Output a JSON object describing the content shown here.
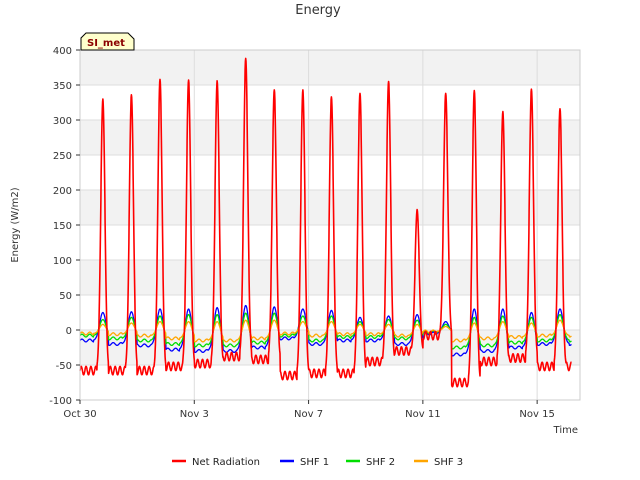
{
  "chart_data": {
    "type": "line",
    "title": "Energy",
    "xlabel": "Time",
    "ylabel": "Energy (W/m2)",
    "badge": "SI_met",
    "ylim": [
      -100,
      400
    ],
    "yticks": [
      -100,
      -50,
      0,
      50,
      100,
      150,
      200,
      250,
      300,
      350,
      400
    ],
    "xlim": [
      0,
      17.5
    ],
    "xticks": [
      {
        "label": "Oct 30",
        "day": 0
      },
      {
        "label": "Nov 3",
        "day": 4
      },
      {
        "label": "Nov 7",
        "day": 8
      },
      {
        "label": "Nov 11",
        "day": 12
      },
      {
        "label": "Nov 15",
        "day": 16
      }
    ],
    "x_units": "days since Oct 30",
    "daily_peaks_day_offset": [
      0.8,
      1.8,
      2.8,
      3.8,
      4.8,
      5.8,
      6.8,
      7.8,
      8.8,
      9.8,
      10.8,
      11.8,
      12.8,
      13.8,
      14.8,
      15.8,
      16.8
    ],
    "series": [
      {
        "name": "Net Radiation",
        "color": "#ff0000",
        "daily_peak": [
          330,
          336,
          358,
          357,
          356,
          388,
          343,
          343,
          333,
          338,
          355,
          172,
          338,
          342,
          312,
          344,
          316
        ],
        "night_min": [
          -58,
          -58,
          -58,
          -52,
          -48,
          -38,
          -42,
          -65,
          -62,
          -62,
          -45,
          -30,
          -8,
          -75,
          -45,
          -40,
          -52
        ]
      },
      {
        "name": "SHF 1",
        "color": "#0000ff",
        "daily_peak": [
          25,
          26,
          30,
          30,
          32,
          35,
          33,
          30,
          28,
          18,
          20,
          22,
          12,
          30,
          30,
          25,
          30
        ],
        "night_min": [
          -15,
          -20,
          -22,
          -28,
          -30,
          -30,
          -25,
          -12,
          -20,
          -15,
          -15,
          -20,
          -5,
          -35,
          -30,
          -25,
          -20
        ]
      },
      {
        "name": "SHF 2",
        "color": "#00dd00",
        "daily_peak": [
          15,
          18,
          20,
          22,
          22,
          24,
          24,
          20,
          20,
          12,
          15,
          14,
          8,
          18,
          20,
          18,
          22
        ],
        "night_min": [
          -8,
          -12,
          -15,
          -20,
          -22,
          -22,
          -18,
          -8,
          -15,
          -10,
          -10,
          -12,
          -3,
          -25,
          -22,
          -18,
          -15
        ]
      },
      {
        "name": "SHF 3",
        "color": "#ffa500",
        "daily_peak": [
          8,
          10,
          12,
          12,
          12,
          14,
          14,
          12,
          12,
          8,
          8,
          8,
          5,
          10,
          12,
          10,
          14
        ],
        "night_min": [
          -5,
          -6,
          -8,
          -12,
          -15,
          -15,
          -12,
          -5,
          -8,
          -6,
          -6,
          -8,
          -2,
          -15,
          -12,
          -10,
          -8
        ]
      }
    ],
    "grid": true,
    "legend_position": "bottom-center"
  }
}
